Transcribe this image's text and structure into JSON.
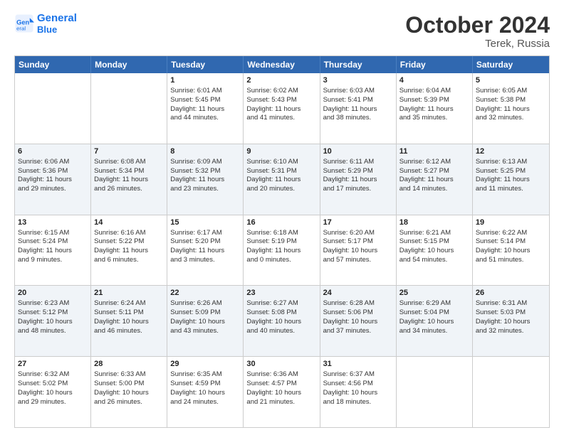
{
  "header": {
    "logo_line1": "General",
    "logo_line2": "Blue",
    "title": "October 2024",
    "subtitle": "Terek, Russia"
  },
  "weekdays": [
    "Sunday",
    "Monday",
    "Tuesday",
    "Wednesday",
    "Thursday",
    "Friday",
    "Saturday"
  ],
  "rows": [
    [
      {
        "day": "",
        "lines": []
      },
      {
        "day": "",
        "lines": []
      },
      {
        "day": "1",
        "lines": [
          "Sunrise: 6:01 AM",
          "Sunset: 5:45 PM",
          "Daylight: 11 hours",
          "and 44 minutes."
        ]
      },
      {
        "day": "2",
        "lines": [
          "Sunrise: 6:02 AM",
          "Sunset: 5:43 PM",
          "Daylight: 11 hours",
          "and 41 minutes."
        ]
      },
      {
        "day": "3",
        "lines": [
          "Sunrise: 6:03 AM",
          "Sunset: 5:41 PM",
          "Daylight: 11 hours",
          "and 38 minutes."
        ]
      },
      {
        "day": "4",
        "lines": [
          "Sunrise: 6:04 AM",
          "Sunset: 5:39 PM",
          "Daylight: 11 hours",
          "and 35 minutes."
        ]
      },
      {
        "day": "5",
        "lines": [
          "Sunrise: 6:05 AM",
          "Sunset: 5:38 PM",
          "Daylight: 11 hours",
          "and 32 minutes."
        ]
      }
    ],
    [
      {
        "day": "6",
        "lines": [
          "Sunrise: 6:06 AM",
          "Sunset: 5:36 PM",
          "Daylight: 11 hours",
          "and 29 minutes."
        ]
      },
      {
        "day": "7",
        "lines": [
          "Sunrise: 6:08 AM",
          "Sunset: 5:34 PM",
          "Daylight: 11 hours",
          "and 26 minutes."
        ]
      },
      {
        "day": "8",
        "lines": [
          "Sunrise: 6:09 AM",
          "Sunset: 5:32 PM",
          "Daylight: 11 hours",
          "and 23 minutes."
        ]
      },
      {
        "day": "9",
        "lines": [
          "Sunrise: 6:10 AM",
          "Sunset: 5:31 PM",
          "Daylight: 11 hours",
          "and 20 minutes."
        ]
      },
      {
        "day": "10",
        "lines": [
          "Sunrise: 6:11 AM",
          "Sunset: 5:29 PM",
          "Daylight: 11 hours",
          "and 17 minutes."
        ]
      },
      {
        "day": "11",
        "lines": [
          "Sunrise: 6:12 AM",
          "Sunset: 5:27 PM",
          "Daylight: 11 hours",
          "and 14 minutes."
        ]
      },
      {
        "day": "12",
        "lines": [
          "Sunrise: 6:13 AM",
          "Sunset: 5:25 PM",
          "Daylight: 11 hours",
          "and 11 minutes."
        ]
      }
    ],
    [
      {
        "day": "13",
        "lines": [
          "Sunrise: 6:15 AM",
          "Sunset: 5:24 PM",
          "Daylight: 11 hours",
          "and 9 minutes."
        ]
      },
      {
        "day": "14",
        "lines": [
          "Sunrise: 6:16 AM",
          "Sunset: 5:22 PM",
          "Daylight: 11 hours",
          "and 6 minutes."
        ]
      },
      {
        "day": "15",
        "lines": [
          "Sunrise: 6:17 AM",
          "Sunset: 5:20 PM",
          "Daylight: 11 hours",
          "and 3 minutes."
        ]
      },
      {
        "day": "16",
        "lines": [
          "Sunrise: 6:18 AM",
          "Sunset: 5:19 PM",
          "Daylight: 11 hours",
          "and 0 minutes."
        ]
      },
      {
        "day": "17",
        "lines": [
          "Sunrise: 6:20 AM",
          "Sunset: 5:17 PM",
          "Daylight: 10 hours",
          "and 57 minutes."
        ]
      },
      {
        "day": "18",
        "lines": [
          "Sunrise: 6:21 AM",
          "Sunset: 5:15 PM",
          "Daylight: 10 hours",
          "and 54 minutes."
        ]
      },
      {
        "day": "19",
        "lines": [
          "Sunrise: 6:22 AM",
          "Sunset: 5:14 PM",
          "Daylight: 10 hours",
          "and 51 minutes."
        ]
      }
    ],
    [
      {
        "day": "20",
        "lines": [
          "Sunrise: 6:23 AM",
          "Sunset: 5:12 PM",
          "Daylight: 10 hours",
          "and 48 minutes."
        ]
      },
      {
        "day": "21",
        "lines": [
          "Sunrise: 6:24 AM",
          "Sunset: 5:11 PM",
          "Daylight: 10 hours",
          "and 46 minutes."
        ]
      },
      {
        "day": "22",
        "lines": [
          "Sunrise: 6:26 AM",
          "Sunset: 5:09 PM",
          "Daylight: 10 hours",
          "and 43 minutes."
        ]
      },
      {
        "day": "23",
        "lines": [
          "Sunrise: 6:27 AM",
          "Sunset: 5:08 PM",
          "Daylight: 10 hours",
          "and 40 minutes."
        ]
      },
      {
        "day": "24",
        "lines": [
          "Sunrise: 6:28 AM",
          "Sunset: 5:06 PM",
          "Daylight: 10 hours",
          "and 37 minutes."
        ]
      },
      {
        "day": "25",
        "lines": [
          "Sunrise: 6:29 AM",
          "Sunset: 5:04 PM",
          "Daylight: 10 hours",
          "and 34 minutes."
        ]
      },
      {
        "day": "26",
        "lines": [
          "Sunrise: 6:31 AM",
          "Sunset: 5:03 PM",
          "Daylight: 10 hours",
          "and 32 minutes."
        ]
      }
    ],
    [
      {
        "day": "27",
        "lines": [
          "Sunrise: 6:32 AM",
          "Sunset: 5:02 PM",
          "Daylight: 10 hours",
          "and 29 minutes."
        ]
      },
      {
        "day": "28",
        "lines": [
          "Sunrise: 6:33 AM",
          "Sunset: 5:00 PM",
          "Daylight: 10 hours",
          "and 26 minutes."
        ]
      },
      {
        "day": "29",
        "lines": [
          "Sunrise: 6:35 AM",
          "Sunset: 4:59 PM",
          "Daylight: 10 hours",
          "and 24 minutes."
        ]
      },
      {
        "day": "30",
        "lines": [
          "Sunrise: 6:36 AM",
          "Sunset: 4:57 PM",
          "Daylight: 10 hours",
          "and 21 minutes."
        ]
      },
      {
        "day": "31",
        "lines": [
          "Sunrise: 6:37 AM",
          "Sunset: 4:56 PM",
          "Daylight: 10 hours",
          "and 18 minutes."
        ]
      },
      {
        "day": "",
        "lines": []
      },
      {
        "day": "",
        "lines": []
      }
    ]
  ]
}
